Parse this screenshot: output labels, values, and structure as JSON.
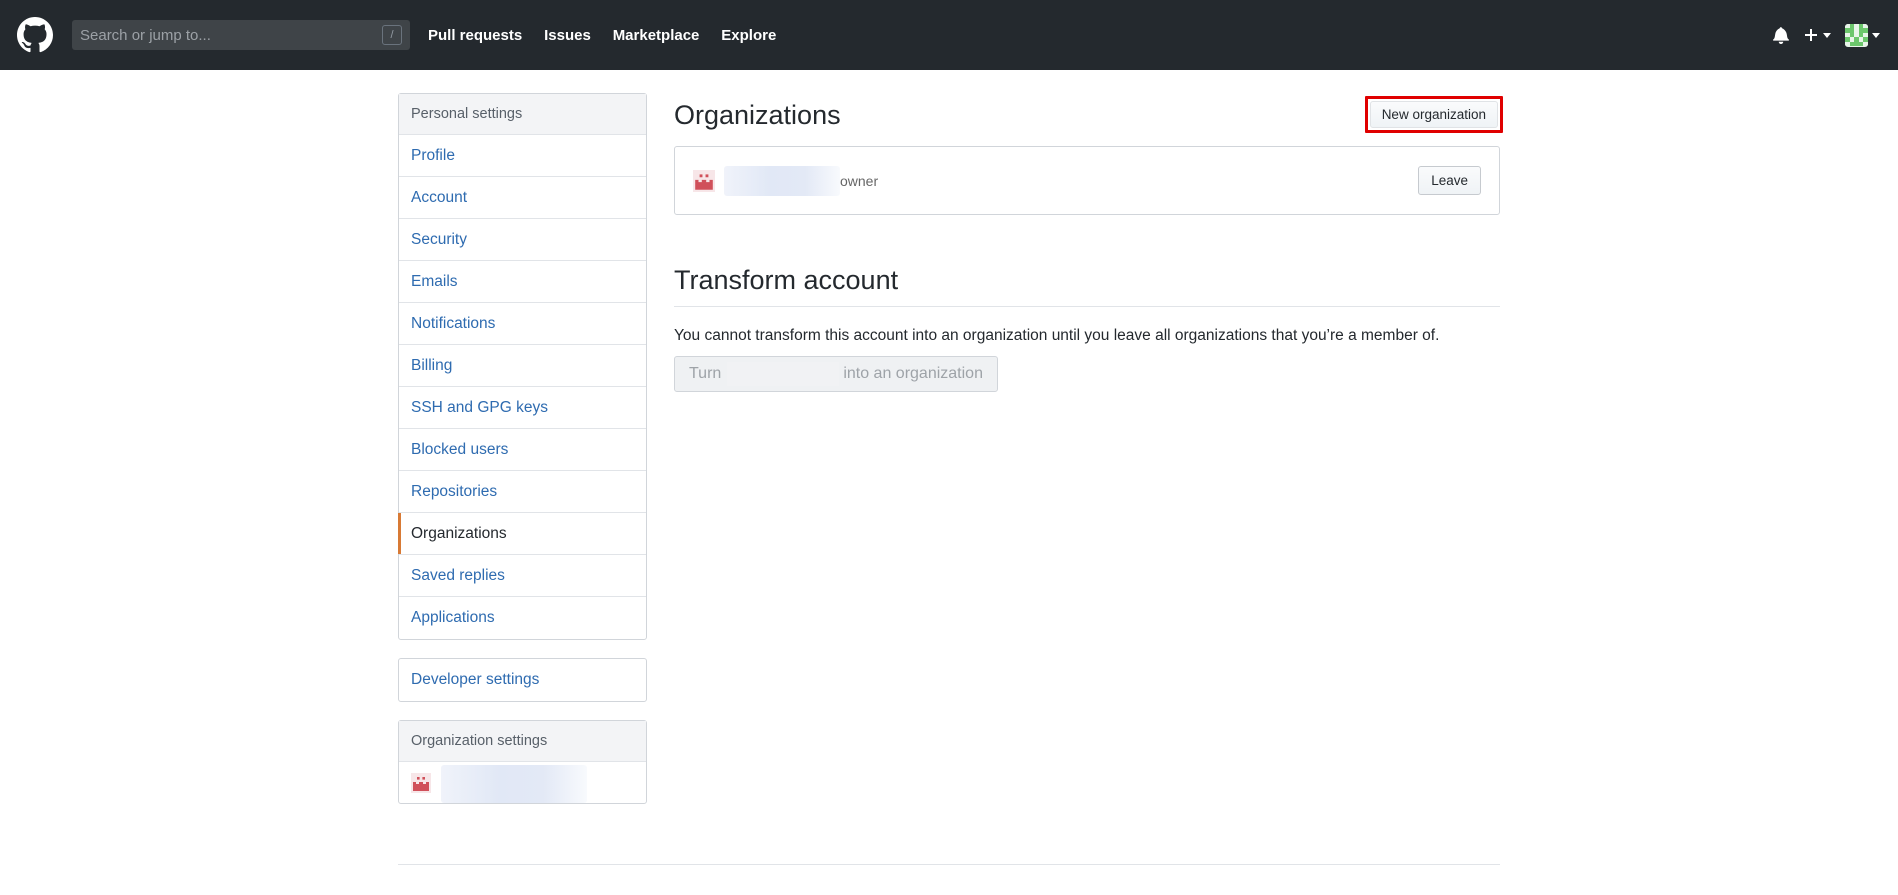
{
  "header": {
    "logo": "github-octocat-icon",
    "search": {
      "placeholder": "Search or jump to...",
      "value": "",
      "shortcut": "/"
    },
    "nav": [
      {
        "label": "Pull requests"
      },
      {
        "label": "Issues"
      },
      {
        "label": "Marketplace"
      },
      {
        "label": "Explore"
      }
    ],
    "right_icons": [
      "bell-icon",
      "plus-icon",
      "avatar-icon"
    ]
  },
  "sidebar": {
    "personal": {
      "heading": "Personal settings",
      "items": [
        {
          "label": "Profile",
          "selected": false
        },
        {
          "label": "Account",
          "selected": false
        },
        {
          "label": "Security",
          "selected": false
        },
        {
          "label": "Emails",
          "selected": false
        },
        {
          "label": "Notifications",
          "selected": false
        },
        {
          "label": "Billing",
          "selected": false
        },
        {
          "label": "SSH and GPG keys",
          "selected": false
        },
        {
          "label": "Blocked users",
          "selected": false
        },
        {
          "label": "Repositories",
          "selected": false
        },
        {
          "label": "Organizations",
          "selected": true
        },
        {
          "label": "Saved replies",
          "selected": false
        },
        {
          "label": "Applications",
          "selected": false
        }
      ]
    },
    "developer": {
      "label": "Developer settings"
    },
    "organization": {
      "heading": "Organization settings",
      "org_name": ""
    }
  },
  "main": {
    "title": "Organizations",
    "new_org_button": "New organization",
    "highlight_color": "#e00000",
    "orgs": [
      {
        "name": "",
        "role": "owner",
        "leave_label": "Leave"
      }
    ],
    "transform": {
      "title": "Transform account",
      "description": "You cannot transform this account into an organization until you leave all organizations that you’re a member of.",
      "button_prefix": "Turn",
      "button_suffix": "into an organization",
      "button_disabled": true
    }
  },
  "colors": {
    "header_bg": "#24292e",
    "link": "#2e6bb0",
    "selected_accent": "#d87a35",
    "org_avatar": "#d0505a"
  }
}
